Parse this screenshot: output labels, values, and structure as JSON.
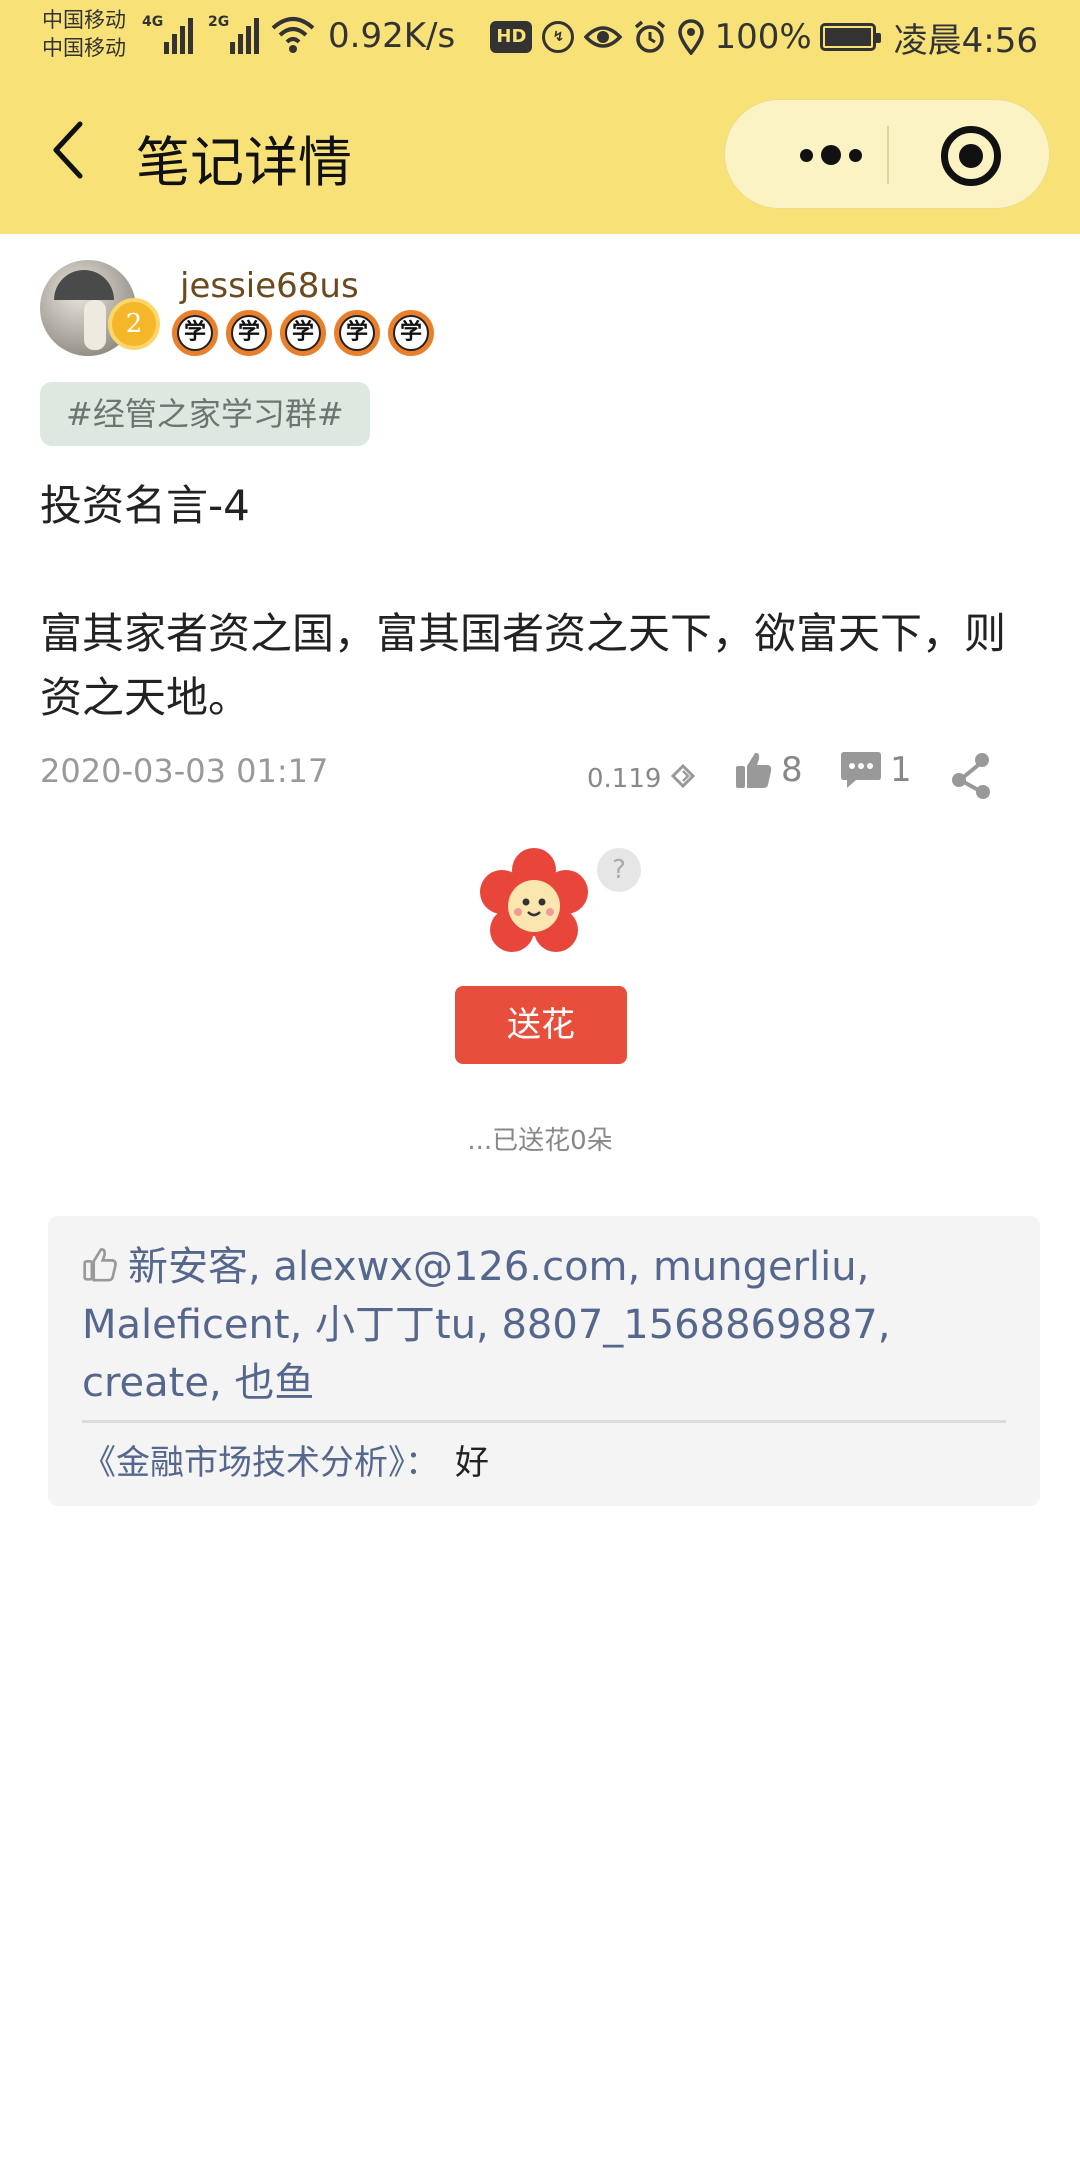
{
  "status_bar": {
    "carrier_1": "中国移动",
    "carrier_2": "中国移动",
    "net_1": "4G",
    "net_2": "2G",
    "net_speed": "0.92K/s",
    "hd": "HD",
    "battery": "100%",
    "time": "凌晨4:56"
  },
  "nav": {
    "title": "笔记详情"
  },
  "author": {
    "username": "jessie68us",
    "level": "2",
    "medals": [
      "学",
      "学",
      "学",
      "学",
      "学"
    ]
  },
  "note": {
    "group_tag": "#经管之家学习群#",
    "title_line": "投资名言-4",
    "body_line": "富其家者资之国，富其国者资之天下，欲富天下，则资之天地。",
    "date": "2020-03-03 01:17",
    "score": "0.119",
    "like_count": "8",
    "comment_count": "1"
  },
  "flower": {
    "help": "?",
    "button_label": "送花",
    "sent_text": "...已送花0朵"
  },
  "interactions": {
    "likers": "新安客, alexwx@126.com, mungerliu, Maleficent, 小丁丁tu, 8807_1568869887, create, 也鱼",
    "comment_author": "《金融市场技术分析》：",
    "comment_text": "好"
  },
  "colors": {
    "header_bg": "#f8e278",
    "send_button": "#e84e3c",
    "link_blue": "#56678e"
  }
}
